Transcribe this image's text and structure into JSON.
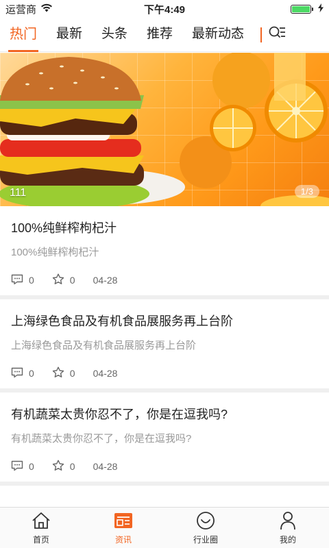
{
  "status_bar": {
    "carrier": "运营商",
    "time": "下午4:49"
  },
  "tabs": [
    {
      "label": "热门",
      "active": true
    },
    {
      "label": "最新"
    },
    {
      "label": "头条"
    },
    {
      "label": "推荐"
    },
    {
      "label": "最新动态"
    }
  ],
  "banner": {
    "caption": "111",
    "pager": "1/3"
  },
  "news": [
    {
      "title": "100%纯鲜榨枸杞汁",
      "summary": "100%纯鲜榨枸杞汁",
      "comments": "0",
      "likes": "0",
      "date": "04-28"
    },
    {
      "title": "上海绿色食品及有机食品展服务再上台阶",
      "summary": "上海绿色食品及有机食品展服务再上台阶",
      "comments": "0",
      "likes": "0",
      "date": "04-28"
    },
    {
      "title": "有机蔬菜太贵你忍不了，你是在逗我吗?",
      "summary": "有机蔬菜太贵你忍不了，你是在逗我吗?",
      "comments": "0",
      "likes": "0",
      "date": "04-28"
    }
  ],
  "bottom_nav": [
    {
      "label": "首页",
      "icon": "home-icon"
    },
    {
      "label": "资讯",
      "icon": "news-icon",
      "active": true
    },
    {
      "label": "行业圈",
      "icon": "circle-icon"
    },
    {
      "label": "我的",
      "icon": "user-icon"
    }
  ],
  "colors": {
    "accent": "#f26522",
    "battery": "#4cd964"
  }
}
